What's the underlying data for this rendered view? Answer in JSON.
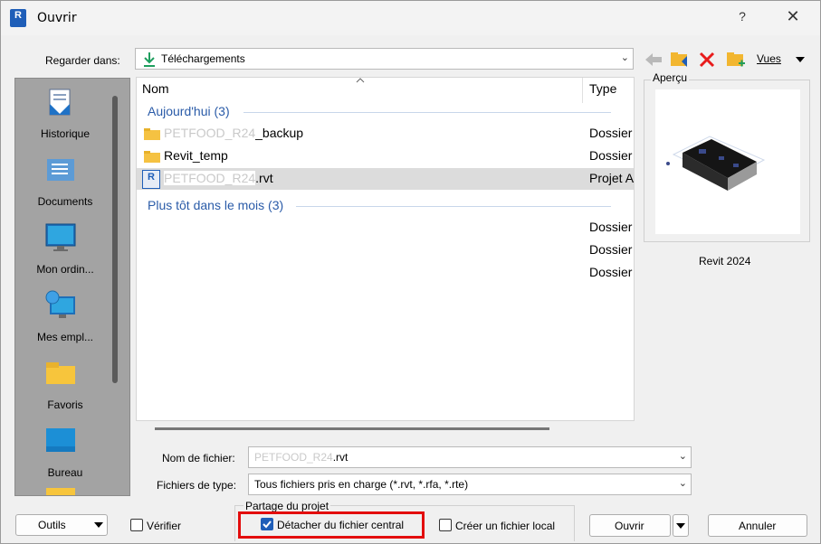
{
  "window": {
    "title": "Ouvrir",
    "help_symbol": "?",
    "close_symbol": "✕",
    "app_logo_letter": "R"
  },
  "look_in": {
    "label": "Regarder dans:",
    "value": "Téléchargements"
  },
  "toolbar": {
    "views_label": "Vues",
    "icons": [
      "back-arrow-icon",
      "up-folder-icon",
      "delete-icon",
      "new-folder-icon",
      "views-icon"
    ]
  },
  "places": [
    {
      "label": "Historique",
      "icon": "history-icon"
    },
    {
      "label": "Documents",
      "icon": "documents-icon"
    },
    {
      "label": "Mon ordin...",
      "icon": "computer-icon"
    },
    {
      "label": "Mes empl...",
      "icon": "network-places-icon"
    },
    {
      "label": "Favoris",
      "icon": "favorites-folder-icon"
    },
    {
      "label": "Bureau",
      "icon": "desktop-icon"
    }
  ],
  "filelist": {
    "columns": {
      "name": "Nom",
      "type": "Type"
    },
    "groups": [
      {
        "title": "Aujourd'hui (3)"
      },
      {
        "title": "Plus tôt dans le mois (3)"
      }
    ],
    "today_items": [
      {
        "name_hidden": "PETFOOD_R24",
        "name_suffix": "_backup",
        "type": "Dossier",
        "icon": "folder-icon"
      },
      {
        "name_hidden": "",
        "name_suffix": "Revit_temp",
        "type": "Dossier",
        "icon": "folder-icon"
      },
      {
        "name_hidden": "PETFOOD_R24",
        "name_suffix": ".rvt",
        "type": "Projet A",
        "icon": "revit-file-icon"
      }
    ],
    "earlier_items": [
      {
        "type": "Dossier"
      },
      {
        "type": "Dossier"
      },
      {
        "type": "Dossier"
      }
    ]
  },
  "preview": {
    "label": "Aperçu",
    "caption": "Revit 2024"
  },
  "filename": {
    "label": "Nom de fichier:",
    "value_hidden": "PETFOOD_R24",
    "value_suffix": ".rvt"
  },
  "filetype": {
    "label": "Fichiers de type:",
    "value": "Tous fichiers pris en charge  (*.rvt, *.rfa, *.rte)"
  },
  "worksharing": {
    "group_label": "Partage du projet",
    "detach_label": "Détacher du fichier central",
    "detach_checked": true,
    "create_local_label": "Créer un fichier local",
    "create_local_checked": false
  },
  "buttons": {
    "tools": "Outils",
    "audit": "Vérifier",
    "open": "Ouvrir",
    "cancel": "Annuler"
  },
  "colors": {
    "accent_blue": "#1f5eb8",
    "highlight_red": "#e30d0d",
    "group_text": "#2a5ba8"
  }
}
